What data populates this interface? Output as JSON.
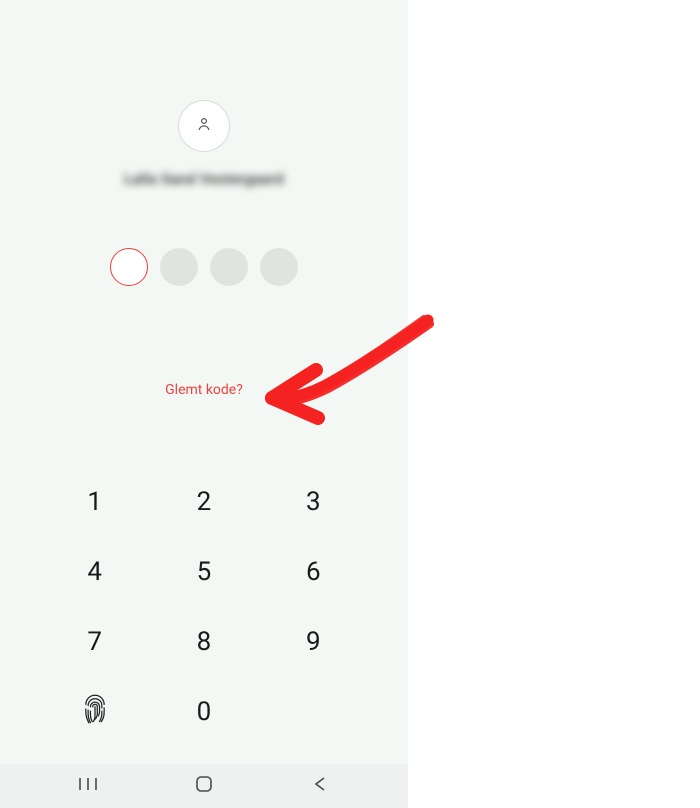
{
  "user": {
    "display_name": "Lalla Sand Vestergaard"
  },
  "pin": {
    "length": 4,
    "entered": 0
  },
  "links": {
    "forgot": "Glemt kode?"
  },
  "keypad": {
    "keys": [
      "1",
      "2",
      "3",
      "4",
      "5",
      "6",
      "7",
      "8",
      "9",
      "",
      "0",
      ""
    ]
  },
  "icons": {
    "avatar": "person-icon",
    "fingerprint": "fingerprint-icon"
  },
  "nav": {
    "recent": "recent-apps",
    "home": "home",
    "back": "back"
  },
  "colors": {
    "accent": "#f03f3f",
    "bg": "#f4f8f5"
  }
}
